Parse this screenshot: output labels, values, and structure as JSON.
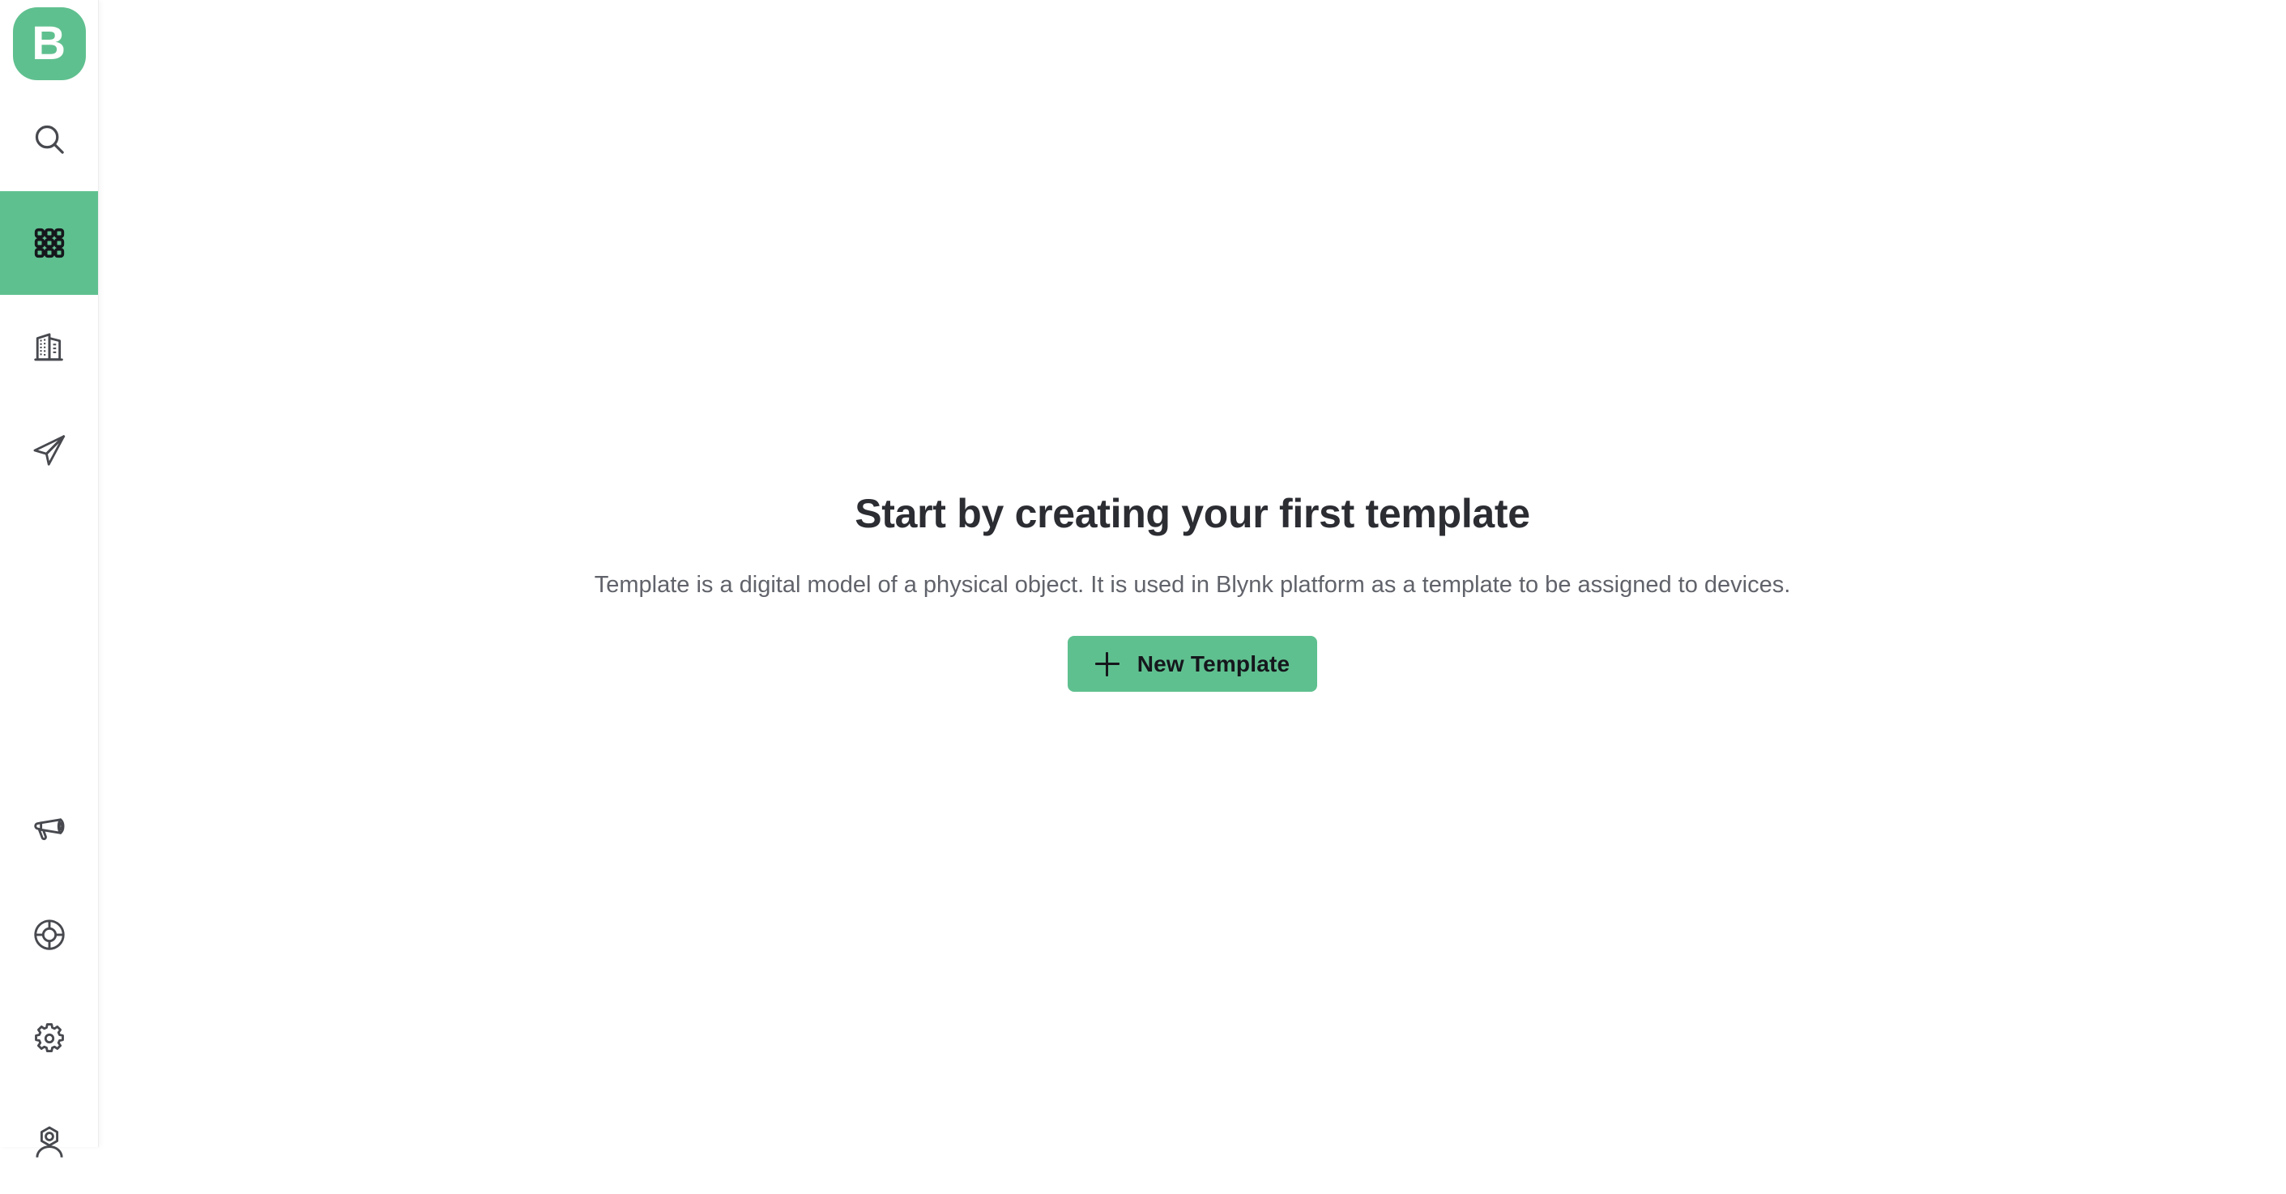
{
  "app": {
    "brand_initial": "B",
    "accent_color": "#5fc08f",
    "icon_color": "#47494f",
    "title_color": "#2b2d33",
    "subtitle_color": "#61636b"
  },
  "sidebar": {
    "logo_name": "blynk-logo",
    "top_items": [
      {
        "name": "search",
        "label": "Search",
        "icon": "search-icon",
        "active": false
      },
      {
        "name": "templates",
        "label": "Templates",
        "icon": "grid-icon",
        "active": true
      },
      {
        "name": "organizations",
        "label": "Organizations",
        "icon": "building-icon",
        "active": false
      },
      {
        "name": "developer",
        "label": "Developer",
        "icon": "paper-plane-icon",
        "active": false
      }
    ],
    "bottom_items": [
      {
        "name": "announcements",
        "label": "Announcements",
        "icon": "megaphone-icon",
        "active": false
      },
      {
        "name": "support",
        "label": "Support",
        "icon": "lifebuoy-icon",
        "active": false
      },
      {
        "name": "settings",
        "label": "Settings",
        "icon": "gear-icon",
        "active": false
      },
      {
        "name": "account",
        "label": "Account",
        "icon": "user-avatar-icon",
        "active": false
      }
    ]
  },
  "main": {
    "empty_state": {
      "title": "Start by creating your first template",
      "subtitle": "Template is a digital model of a physical object. It is used in Blynk platform as a template to be assigned to devices.",
      "button_label": "New Template",
      "button_icon": "plus-icon"
    }
  }
}
